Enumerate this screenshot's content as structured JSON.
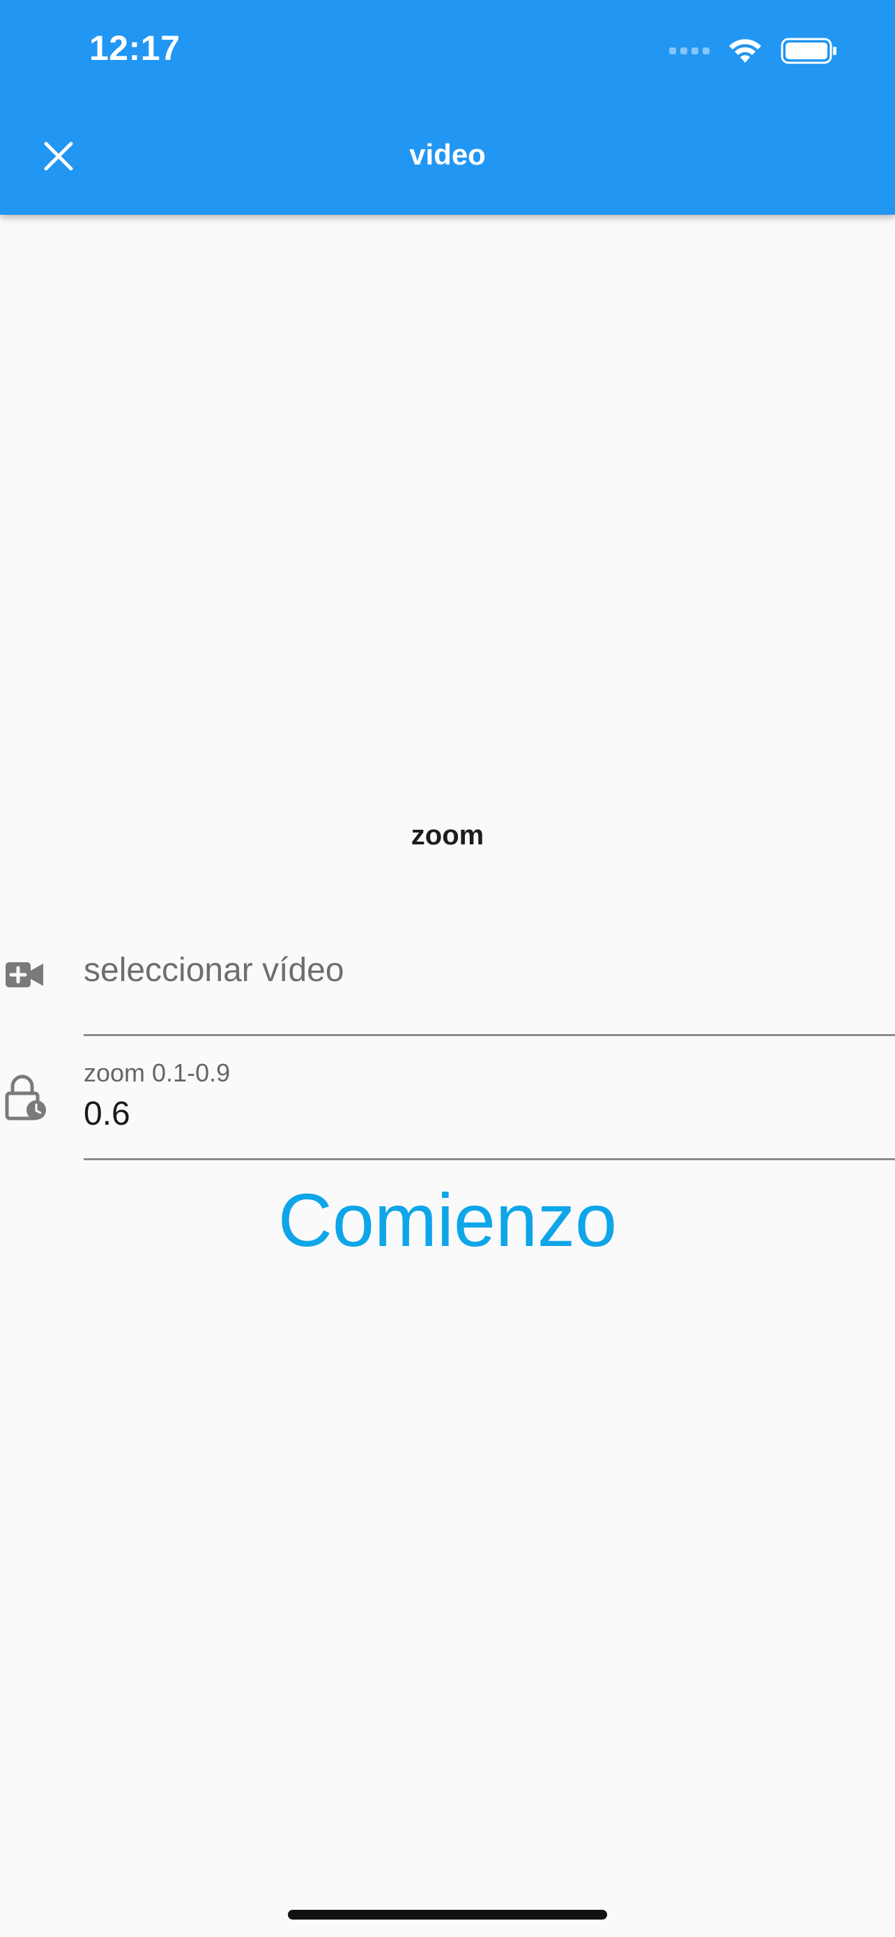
{
  "status_bar": {
    "time": "12:17",
    "icons": [
      "cellular-signal-icon",
      "wifi-icon",
      "battery-icon"
    ]
  },
  "app_bar": {
    "title": "video",
    "close_icon": "close-icon",
    "background_color": "#2196f3"
  },
  "main": {
    "section_heading": "zoom",
    "video_field": {
      "icon": "video-add-icon",
      "placeholder": "seleccionar vídeo"
    },
    "zoom_field": {
      "icon": "lock-clock-icon",
      "label": "zoom 0.1-0.9",
      "value": "0.6"
    },
    "start_button": {
      "label": "Comienzo",
      "color": "#0ea5e9"
    }
  }
}
